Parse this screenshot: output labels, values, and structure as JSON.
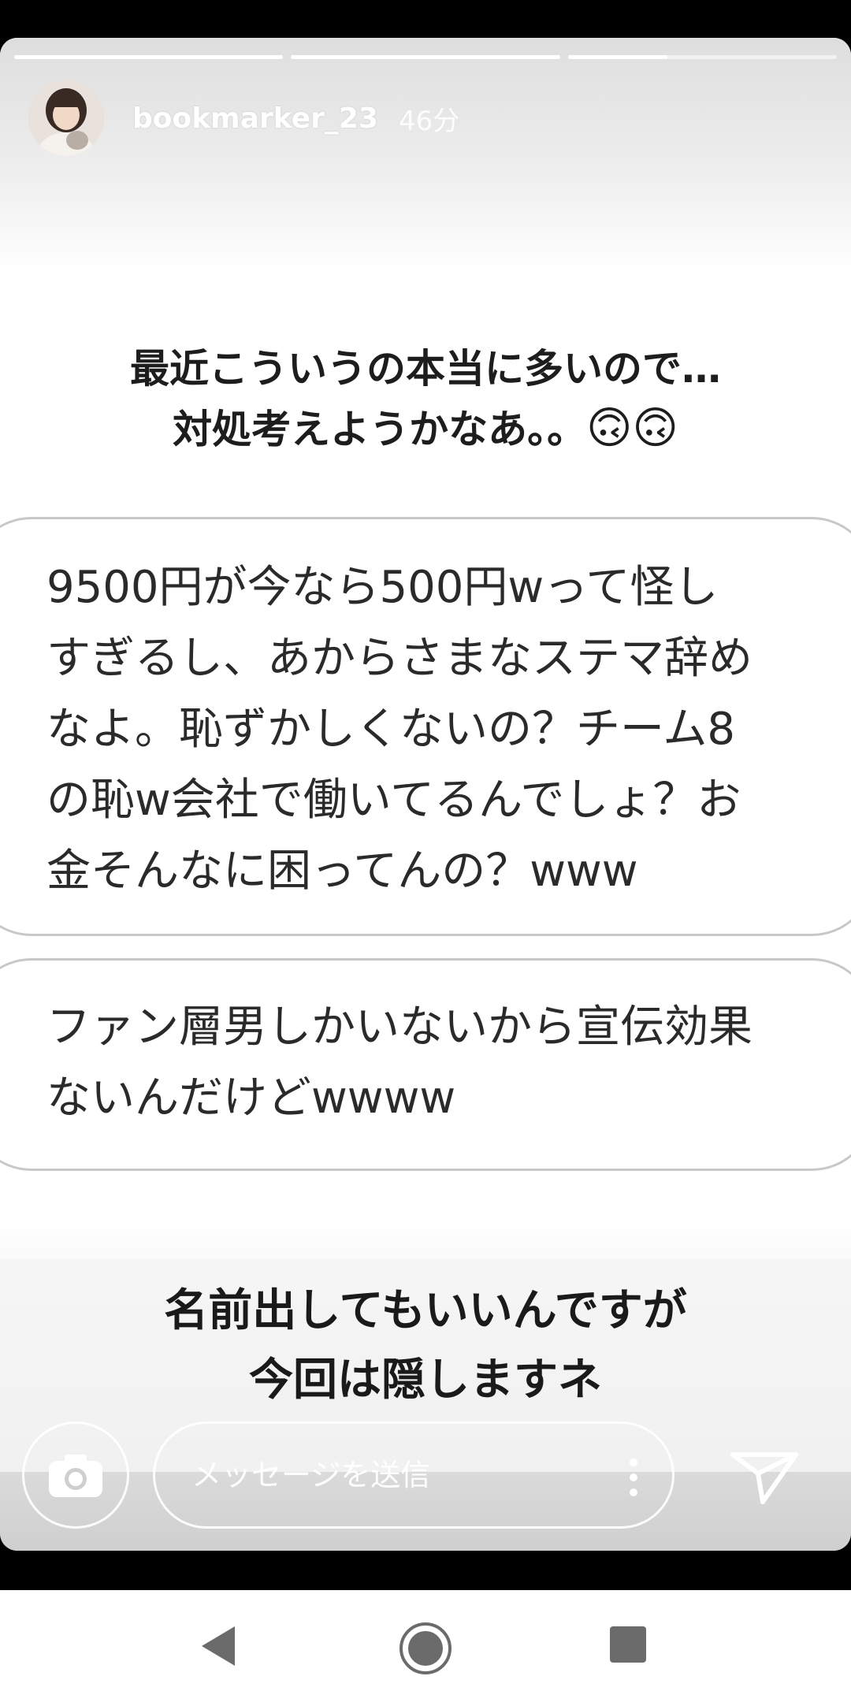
{
  "story": {
    "progress_segments": [
      {
        "fill_fraction": 1.0
      },
      {
        "fill_fraction": 1.0
      },
      {
        "fill_fraction": 0.37
      },
      {
        "fill_fraction": 0.0
      }
    ],
    "username": "bookmarker_23",
    "time_ago": "46分",
    "caption_line1": "最近こういうの本当に多いので…",
    "caption_line2": "対処考えようかなあ。。",
    "caption_emoji": "🙃🙃",
    "bubble1": {
      "lines": [
        "9500円が今なら500円wって怪し",
        "すぎるし、あからさまなステマ辞め",
        "なよ。恥ずかしくないの？チーム8",
        "の恥w会社で働いてるんでしょ？お",
        "金そんなに困ってんの？www"
      ]
    },
    "bubble2": {
      "lines": [
        "ファン層男しかいないから宣伝効果",
        "ないんだけどwwww"
      ]
    },
    "overlay_line1": "名前出してもいいんですが",
    "overlay_line2": "今回は隠しますネ"
  },
  "reply_bar": {
    "camera_icon": "camera-icon",
    "message_placeholder": "メッセージを送信",
    "more_icon": "more-vertical-icon",
    "send_icon": "send-icon"
  },
  "nav_bar": {
    "back_icon": "back-triangle-icon",
    "home_icon": "home-circle-icon",
    "recents_icon": "recents-square-icon"
  }
}
